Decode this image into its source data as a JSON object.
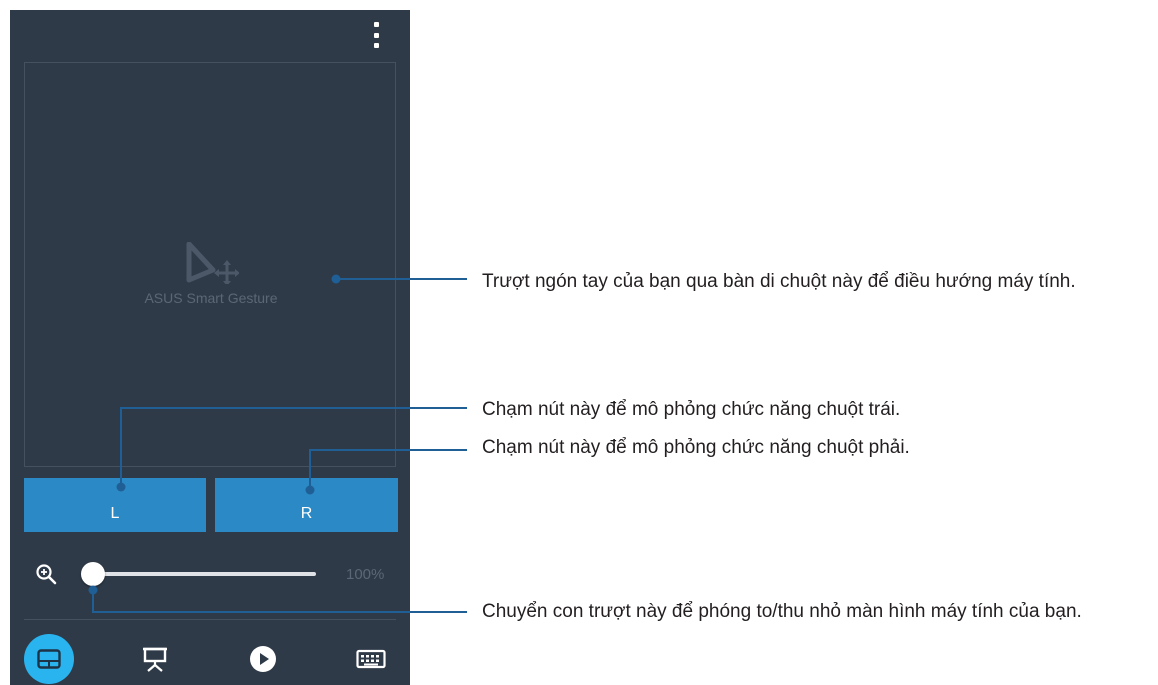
{
  "app": {
    "brand_text": "ASUS Smart Gesture",
    "menu_icon": "more-vert-icon"
  },
  "buttons": {
    "left_label": "L",
    "right_label": "R"
  },
  "zoom": {
    "icon": "zoom-in-icon",
    "value_text": "100%",
    "slider_level": 0
  },
  "nav": {
    "items": [
      {
        "icon": "touchpad-icon",
        "active": true
      },
      {
        "icon": "presentation-icon",
        "active": false
      },
      {
        "icon": "play-icon",
        "active": false
      },
      {
        "icon": "keyboard-icon",
        "active": false
      }
    ]
  },
  "callouts": {
    "touchpad": "Trượt ngón tay của bạn qua bàn di chuột này để điều hướng máy tính.",
    "left_button": "Chạm nút này để mô phỏng chức năng chuột trái.",
    "right_button": "Chạm nút này để mô phỏng chức năng chuột phải.",
    "slider": "Chuyển con trượt này để phóng to/thu nhỏ màn hình máy tính của bạn."
  },
  "colors": {
    "screen_bg": "#2f3a48",
    "button_blue": "#2b8ac5",
    "active_nav": "#29b4ef",
    "callout_line": "#1f5f95"
  }
}
